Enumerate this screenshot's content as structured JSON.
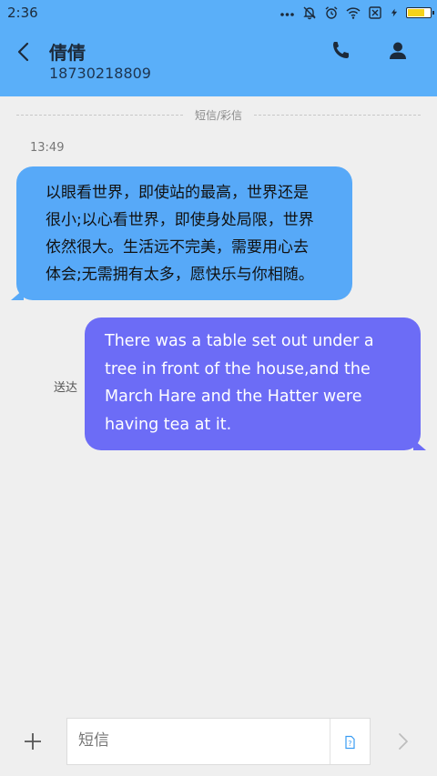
{
  "status_bar": {
    "time": "2:36",
    "icons": [
      "more-dots-icon",
      "mute-bell-icon",
      "alarm-icon",
      "wifi-icon",
      "sim-x-icon",
      "charging-icon",
      "battery-icon"
    ]
  },
  "header": {
    "contact_name": "倩倩",
    "phone_number": "18730218809",
    "background_color": "#5aaff9"
  },
  "thread": {
    "type_divider": "短信/彩信",
    "timestamp": "13:49",
    "incoming": {
      "lines": [
        "以眼看世界，即使站的最高，世界还是",
        "很小;以心看世界，即使身处局限，世界",
        "依然很大。生活远不完美，需要用心去",
        "体会;无需拥有太多，愿快乐与你相随。"
      ],
      "color": "#57a9f8"
    },
    "outgoing": {
      "lines": [
        "There was a table set out under a",
        "tree in front of the house,and the",
        "March Hare and the Hatter were",
        "having tea at it."
      ],
      "status": "送达",
      "color": "#6c6cf6"
    }
  },
  "composer": {
    "placeholder": "短信",
    "value": ""
  }
}
